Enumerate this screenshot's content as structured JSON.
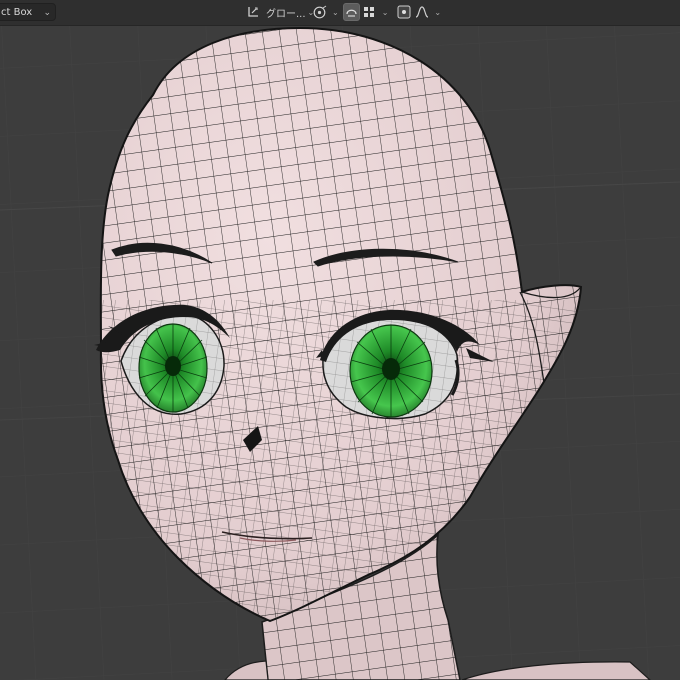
{
  "header": {
    "mode_select": {
      "label": "ct Box"
    },
    "pivot": {
      "label": "グロー..."
    }
  },
  "icons": {
    "pivot": "transform-pivot-icon",
    "snap": "snap-icon",
    "proportional": "proportional-editing-icon",
    "overlay": "overlay-icon",
    "falloff": "falloff-curve-icon"
  },
  "colors": {
    "background": "#3d3d3d",
    "header": "#2f2f2f",
    "skin": "#e8d3d4",
    "wire": "#1c1c1c",
    "eye_green": "#2faa35",
    "eye_dark": "#0d4410",
    "sclera": "#dadada"
  }
}
